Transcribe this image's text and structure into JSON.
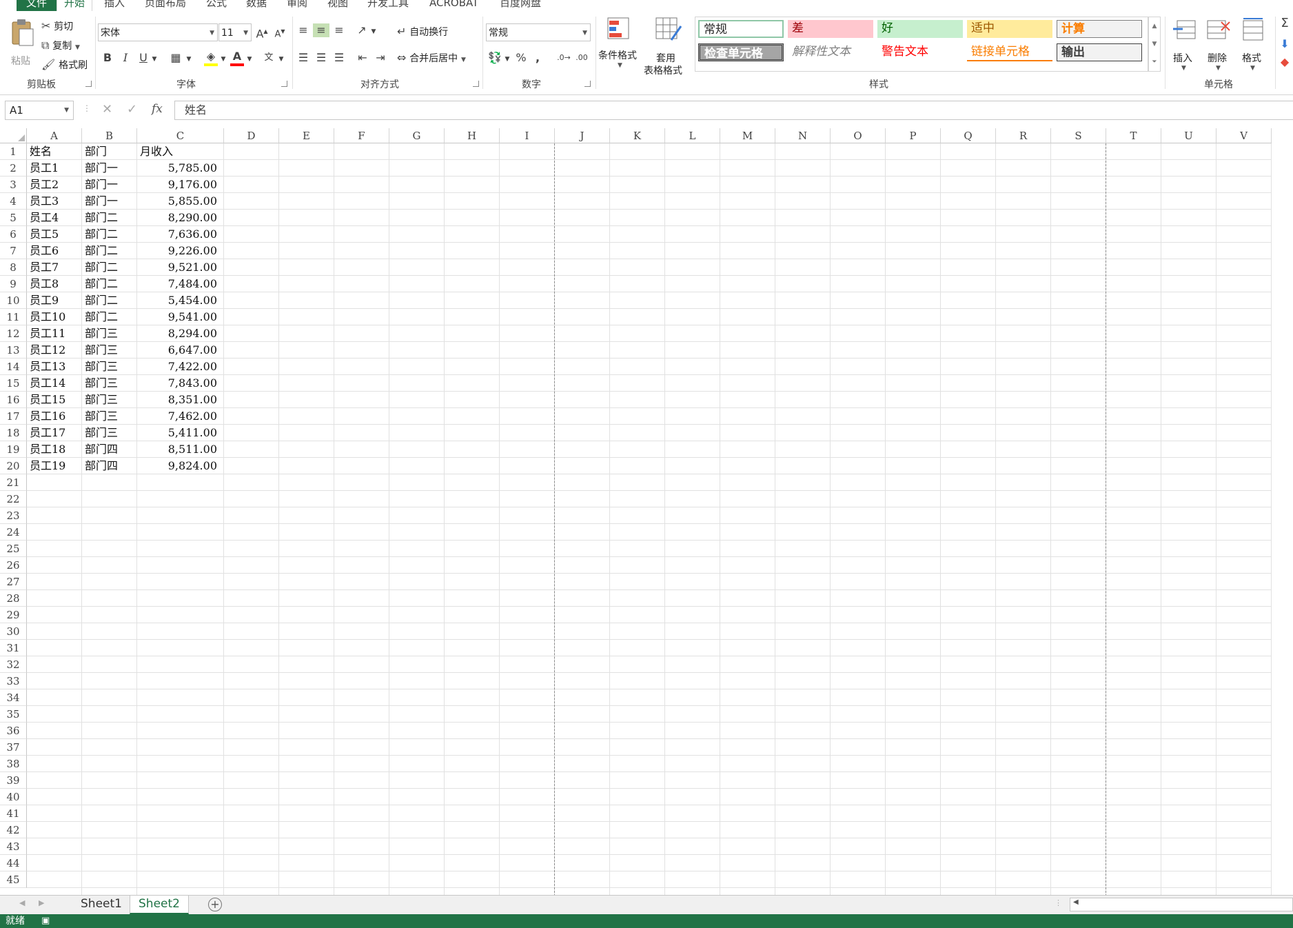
{
  "ribbon": {
    "tabs": [
      "文件",
      "开始",
      "插入",
      "页面布局",
      "公式",
      "数据",
      "审阅",
      "视图",
      "开发工具",
      "ACROBAT",
      "百度网盘"
    ],
    "active_tab": "开始",
    "clipboard": {
      "paste": "粘贴",
      "cut": "剪切",
      "copy": "复制",
      "format_painter": "格式刷",
      "group": "剪贴板"
    },
    "font": {
      "name": "宋体",
      "size": "11",
      "group": "字体",
      "bold": "B",
      "italic": "I",
      "underline": "U",
      "grow": "A",
      "shrink": "A",
      "font_color": "A",
      "phonetic": "文"
    },
    "alignment": {
      "wrap_text": "自动换行",
      "merge_center": "合并后居中",
      "group": "对齐方式"
    },
    "number": {
      "format": "常规",
      "percent": "%",
      "comma": ",",
      "group": "数字"
    },
    "styles": {
      "conditional_format": "条件格式",
      "table_format_line1": "套用",
      "table_format_line2": "表格格式",
      "group": "样式",
      "gallery": [
        "常规",
        "差",
        "好",
        "适中",
        "计算",
        "检查单元格",
        "解释性文本",
        "警告文本",
        "链接单元格",
        "输出"
      ]
    },
    "cells": {
      "insert": "插入",
      "delete": "删除",
      "format": "格式",
      "group": "单元格"
    },
    "editing": {
      "sum": "Σ"
    }
  },
  "formula_bar": {
    "name_box": "A1",
    "fx": "fx",
    "content": "姓名"
  },
  "columns": [
    "A",
    "B",
    "C",
    "D",
    "E",
    "F",
    "G",
    "H",
    "I",
    "J",
    "K",
    "L",
    "M",
    "N",
    "O",
    "P",
    "Q",
    "R",
    "S",
    "T",
    "U",
    "V"
  ],
  "rows": [
    "1",
    "2",
    "3",
    "4",
    "5",
    "6",
    "7",
    "8",
    "9",
    "10",
    "11",
    "12",
    "13",
    "14",
    "15",
    "16",
    "17",
    "18",
    "19",
    "20",
    "21",
    "22",
    "23",
    "24",
    "25",
    "26",
    "27",
    "28",
    "29",
    "30",
    "31",
    "32",
    "33",
    "34",
    "35",
    "36",
    "37",
    "38",
    "39",
    "40",
    "41",
    "42",
    "43",
    "44",
    "45"
  ],
  "table": {
    "headers": [
      "姓名",
      "部门",
      "月收入"
    ],
    "records": [
      [
        "员工1",
        "部门一",
        "5,785.00"
      ],
      [
        "员工2",
        "部门一",
        "9,176.00"
      ],
      [
        "员工3",
        "部门一",
        "5,855.00"
      ],
      [
        "员工4",
        "部门二",
        "8,290.00"
      ],
      [
        "员工5",
        "部门二",
        "7,636.00"
      ],
      [
        "员工6",
        "部门二",
        "9,226.00"
      ],
      [
        "员工7",
        "部门二",
        "9,521.00"
      ],
      [
        "员工8",
        "部门二",
        "7,484.00"
      ],
      [
        "员工9",
        "部门二",
        "5,454.00"
      ],
      [
        "员工10",
        "部门二",
        "9,541.00"
      ],
      [
        "员工11",
        "部门三",
        "8,294.00"
      ],
      [
        "员工12",
        "部门三",
        "6,647.00"
      ],
      [
        "员工13",
        "部门三",
        "7,422.00"
      ],
      [
        "员工14",
        "部门三",
        "7,843.00"
      ],
      [
        "员工15",
        "部门三",
        "8,351.00"
      ],
      [
        "员工16",
        "部门三",
        "7,462.00"
      ],
      [
        "员工17",
        "部门三",
        "5,411.00"
      ],
      [
        "员工18",
        "部门四",
        "8,511.00"
      ],
      [
        "员工19",
        "部门四",
        "9,824.00"
      ]
    ]
  },
  "sheets": [
    "Sheet1",
    "Sheet2"
  ],
  "active_sheet": "Sheet2",
  "status": {
    "ready": "就绪"
  },
  "colors": {
    "accent": "#217346",
    "bad_bg": "#FFC7CE",
    "bad_fg": "#9C0006",
    "good_bg": "#C6EFCE",
    "good_fg": "#006100",
    "neutral_bg": "#FFEB9C",
    "neutral_fg": "#9C5700",
    "calc_fg": "#FA7D00",
    "warning_fg": "#FF0000"
  }
}
